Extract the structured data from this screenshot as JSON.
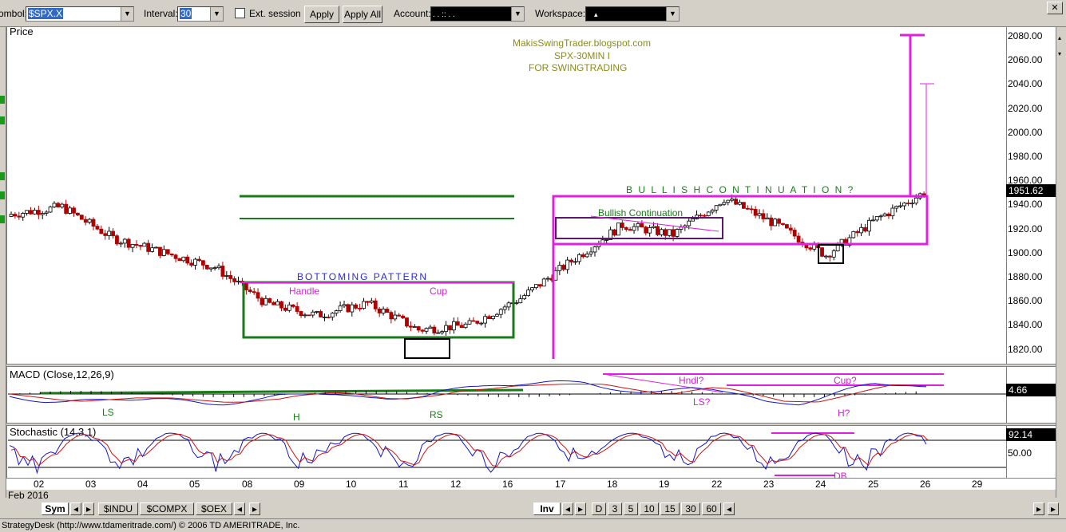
{
  "toolbar": {
    "symbol_label": "ombol:",
    "symbol_value": "$SPX.X",
    "interval_label": "Interval:",
    "interval_value": "30",
    "ext_session_label": "Ext. session",
    "apply_label": "Apply",
    "apply_all_label": "Apply All",
    "account_label": "Account:",
    "account_value": ".     .     ::     .     .",
    "workspace_label": "Workspace:",
    "workspace_value": "▴",
    "close_label": "✕"
  },
  "price_panel": {
    "title": "Price",
    "last_price": "1951.62",
    "y_ticks": [
      "2080.00",
      "2060.00",
      "2040.00",
      "2020.00",
      "2000.00",
      "1980.00",
      "1960.00",
      "1940.00",
      "1920.00",
      "1900.00",
      "1880.00",
      "1860.00",
      "1840.00",
      "1820.00"
    ],
    "annotations": {
      "blog_line1": "MakisSwingTrader.blogspot.com",
      "blog_line2": "SPX-30MIN  I",
      "blog_line3": "FOR SWINGTRADING",
      "bottoming": "BOTTOMING  PATTERN",
      "handle": "Handle",
      "cup": "Cup",
      "bullish_continuation_big": "B U L L I S H    C O N T I N U A T I O N ?",
      "bullish_continuation_small": "Bullish Continuation"
    }
  },
  "macd_panel": {
    "title": "MACD (Close,12,26,9)",
    "value": "4.66",
    "annotations": {
      "ls": "LS",
      "h": "H",
      "rs": "RS",
      "hndl": "Hndl?",
      "ls2": "LS?",
      "cup2": "Cup?",
      "h2": "H?"
    }
  },
  "stoch_panel": {
    "title": "Stochastic (14,3,1)",
    "value": "92.14",
    "level": "50.00",
    "annotation_db": "DB"
  },
  "x_axis": {
    "month_label": "Feb 2016",
    "days": [
      "02",
      "03",
      "04",
      "05",
      "08",
      "09",
      "10",
      "11",
      "12",
      "16",
      "17",
      "18",
      "19",
      "22",
      "23",
      "24",
      "25",
      "26",
      "29"
    ]
  },
  "tabs_left": {
    "sym": "Sym",
    "items": [
      "$INDU",
      "$COMPX",
      "$OEX"
    ]
  },
  "tabs_right": {
    "inv": "Inv",
    "intervals": [
      "D",
      "3",
      "5",
      "10",
      "15",
      "30",
      "60"
    ]
  },
  "status_text": "StrategyDesk (http://www.tdameritrade.com/) © 2006 TD AMERITRADE, Inc.",
  "colors": {
    "pattern_green": "#1a7a1a",
    "magenta": "#e020e0",
    "up_candle": "#000000",
    "down_candle": "#b00000",
    "macd_line": "#1515c8",
    "signal_line": "#c81515",
    "annotation_olive": "#8b8b1a"
  },
  "chart_data": {
    "type": "candlestick",
    "title": "MakisSwingTrader.blogspot.com SPX-30MIN I FOR SWINGTRADING",
    "symbol": "$SPX.X",
    "interval": "30",
    "ylim": [
      1810,
      2090
    ],
    "categories": [
      "02",
      "03",
      "04",
      "05",
      "08",
      "09",
      "10",
      "11",
      "12",
      "16",
      "17",
      "18",
      "19",
      "22",
      "23",
      "24",
      "25",
      "26"
    ],
    "series": [
      {
        "name": "Price",
        "values": [
          1938,
          1912,
          1900,
          1888,
          1858,
          1848,
          1858,
          1836,
          1840,
          1862,
          1893,
          1923,
          1915,
          1945,
          1924,
          1898,
          1928,
          1951.62
        ]
      }
    ],
    "last": 1951.62,
    "macd": 4.66,
    "stochastic": 92.14,
    "stochastic_level": 50.0
  }
}
